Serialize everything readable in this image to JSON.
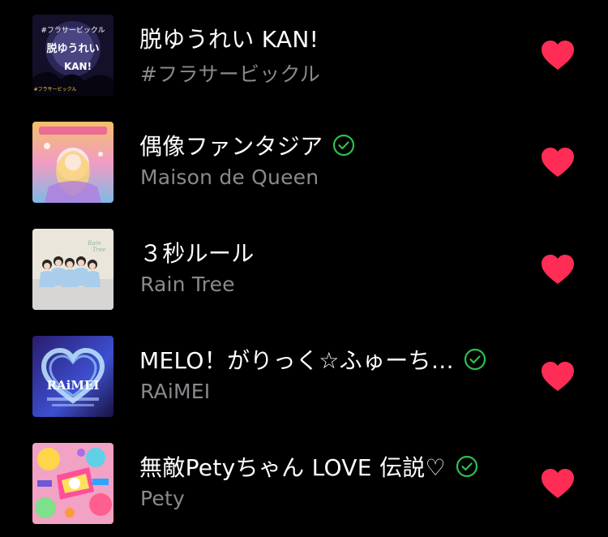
{
  "accent": {
    "heart": "#ff2d55",
    "verified": "#2fbf4f",
    "subtitle": "#8a8a8e"
  },
  "tracks": [
    {
      "title": "脱ゆうれい KAN!",
      "artist": "#フラサービックル",
      "verified": false,
      "liked": true,
      "artwork": "dark-purple-moon-artwork",
      "artwork_text": [
        "#フラサービックル",
        "脱ゆうれい",
        "KAN!",
        "#フラサービックル"
      ]
    },
    {
      "title": "偶像ファンタジア",
      "artist": "Maison de Queen",
      "verified": true,
      "liked": true,
      "artwork": "pastel-fantasy-artwork"
    },
    {
      "title": "３秒ルール",
      "artist": "Rain Tree",
      "verified": false,
      "liked": true,
      "artwork": "group-photo-artwork"
    },
    {
      "title": "MELO！がりっく☆ふゅーち…",
      "artist": "RAiMEI",
      "verified": true,
      "liked": true,
      "artwork": "blue-heart-artwork",
      "artwork_text": [
        "RAiMEI"
      ]
    },
    {
      "title": "無敵Petyちゃん LOVE 伝説♡",
      "artist": "Pety",
      "verified": true,
      "liked": true,
      "artwork": "colorful-pop-artwork"
    }
  ]
}
